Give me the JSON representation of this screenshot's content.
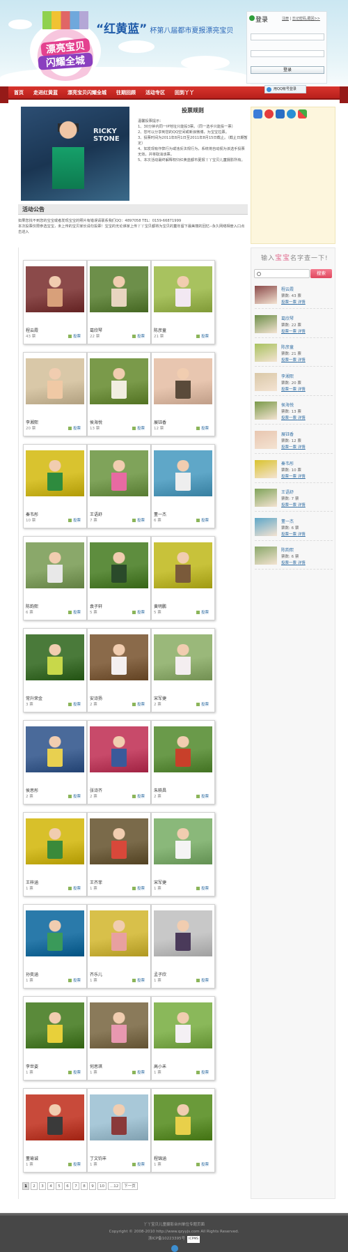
{
  "header": {
    "logo_line1": "漂亮宝贝",
    "logo_line2": "闪耀全城",
    "slogan_quote": "“红黄蓝”",
    "slogan_text": "杯第八届都市夏报漂亮宝贝"
  },
  "login": {
    "title": "登录",
    "register": "注册",
    "forgot": "忘记密码,跟回>>",
    "button": "登录",
    "qq_login": "用QQ帐号登录"
  },
  "nav": {
    "items": [
      "首页",
      "走进红黄蓝",
      "漂亮宝贝闪耀全城",
      "往期回顾",
      "活动专区",
      "回到丫丫"
    ]
  },
  "rules": {
    "title": "投票规则",
    "lines": [
      "温馨投票提示：",
      "1、30分钟内同一IP地址只能投3票。（同一选手只能投一票）",
      "2、您可以分享到您的QQ空间或新浪微博，为宝宝拉票。",
      "3、投票时间为2011年8月1日至2011年8月15日截止。（截止日期暂定）",
      "4、如发现有作弊行为或违反法规行为，系统将自动视为该选手投票无效，并将取消该票。",
      "5、本次活动最终解释权归红黄蓝都市夏报丫丫宝贝儿童摄影所有。"
    ]
  },
  "notice": {
    "title": "活动公告",
    "text1": "如果您找不到您的宝宝或者发现宝宝的照片有错误请联系我们QQ：4897058 TEL：0159-66871999",
    "text2": "本次投票仅限参选宝宝，未上传的宝贝家长请勿投票！宝宝的无论谁家上传丫丫宝贝都将为宝贝的童年留下最美丽的回忆--永久网络相册入口点击进入"
  },
  "gallery": [
    {
      "name": "程云霞",
      "votes": "43 票",
      "vote_label": "投票",
      "c1": "#8b4a4a",
      "c2": "#d8a07a"
    },
    {
      "name": "葛欣琴",
      "votes": "22 票",
      "vote_label": "投票",
      "c1": "#6d8f4a",
      "c2": "#e8d5c0"
    },
    {
      "name": "陈彦童",
      "votes": "21 票",
      "vote_label": "投票",
      "c1": "#a8c25f",
      "c2": "#f2e8f2"
    },
    {
      "name": "李湘熙",
      "votes": "20 票",
      "vote_label": "投票",
      "c1": "#d9c8a8",
      "c2": "#f0c9a5"
    },
    {
      "name": "侯海悦",
      "votes": "13 票",
      "vote_label": "投票",
      "c1": "#7a9a4a",
      "c2": "#f1eee0"
    },
    {
      "name": "展钰香",
      "votes": "12 票",
      "vote_label": "投票",
      "c1": "#e8c6b0",
      "c2": "#5a4a3a"
    },
    {
      "name": "秦韦彤",
      "votes": "10 票",
      "vote_label": "投票",
      "c1": "#d9c32f",
      "c2": "#2e8b3e"
    },
    {
      "name": "王语舒",
      "votes": "7 票",
      "vote_label": "投票",
      "c1": "#7fa35a",
      "c2": "#e86aa2"
    },
    {
      "name": "董一杰",
      "votes": "6 票",
      "vote_label": "投票",
      "c1": "#5fa7c8",
      "c2": "#eeeeee"
    },
    {
      "name": "陈韵熙",
      "votes": "6 票",
      "vote_label": "投票",
      "c1": "#8aa86a",
      "c2": "#e8e8e8"
    },
    {
      "name": "袁子轩",
      "votes": "5 票",
      "vote_label": "投票",
      "c1": "#5e8d3e",
      "c2": "#2a4a2a"
    },
    {
      "name": "黄明鹏",
      "votes": "5 票",
      "vote_label": "投票",
      "c1": "#c8c23a",
      "c2": "#7a5a3a"
    },
    {
      "name": "常升荣金",
      "votes": "3 票",
      "vote_label": "投票",
      "c1": "#4a7a3a",
      "c2": "#c8d84a"
    },
    {
      "name": "安诗扬",
      "votes": "2 票",
      "vote_label": "投票",
      "c1": "#8a6a4a",
      "c2": "#f4f0f0"
    },
    {
      "name": "宋军捷",
      "votes": "2 票",
      "vote_label": "投票",
      "c1": "#9ab87a",
      "c2": "#f4eef0"
    },
    {
      "name": "侯思彤",
      "votes": "2 票",
      "vote_label": "投票",
      "c1": "#4a6a9a",
      "c2": "#e8d050"
    },
    {
      "name": "张诗齐",
      "votes": "2 票",
      "vote_label": "投票",
      "c1": "#c84a6a",
      "c2": "#3a5a9a"
    },
    {
      "name": "朱轶昌",
      "votes": "2 票",
      "vote_label": "投票",
      "c1": "#6a9a4a",
      "c2": "#c8402a"
    },
    {
      "name": "王梓涵",
      "votes": "1 票",
      "vote_label": "投票",
      "c1": "#d8c02a",
      "c2": "#3a8a3a"
    },
    {
      "name": "王齐菲",
      "votes": "1 票",
      "vote_label": "投票",
      "c1": "#7a6a4a",
      "c2": "#d8483a"
    },
    {
      "name": "宋军捷",
      "votes": "1 票",
      "vote_label": "投票",
      "c1": "#8ab87a",
      "c2": "#f4f4f4"
    },
    {
      "name": "孙奕涵",
      "votes": "1 票",
      "vote_label": "投票",
      "c1": "#2a7aaa",
      "c2": "#3a9a5a"
    },
    {
      "name": "齐乐儿",
      "votes": "1 票",
      "vote_label": "投票",
      "c1": "#d8c04a",
      "c2": "#e8a0a0"
    },
    {
      "name": "孟子欣",
      "votes": "1 票",
      "vote_label": "投票",
      "c1": "#c8c8c8",
      "c2": "#4a3a5a"
    },
    {
      "name": "李世姿",
      "votes": "1 票",
      "vote_label": "投票",
      "c1": "#5a8a3a",
      "c2": "#e8d03a"
    },
    {
      "name": "何思琪",
      "votes": "1 票",
      "vote_label": "投票",
      "c1": "#8a7a5a",
      "c2": "#e898b0"
    },
    {
      "name": "高小禾",
      "votes": "1 票",
      "vote_label": "投票",
      "c1": "#8ab85a",
      "c2": "#f4f0f4"
    },
    {
      "name": "董瑜诚",
      "votes": "1 票",
      "vote_label": "投票",
      "c1": "#c84a3a",
      "c2": "#3a3a3a"
    },
    {
      "name": "丁文钧丰",
      "votes": "1 票",
      "vote_label": "投票",
      "c1": "#a8c8d8",
      "c2": "#8a3a3a"
    },
    {
      "name": "程锦涵",
      "votes": "1 票",
      "vote_label": "投票",
      "c1": "#6a9a3a",
      "c2": "#e8d04a"
    }
  ],
  "pager": {
    "pages": [
      "1",
      "2",
      "3",
      "4",
      "5",
      "6",
      "7",
      "8",
      "9",
      "10",
      "...12",
      "下一页"
    ]
  },
  "sidebar": {
    "heading_a": "输入",
    "heading_b": "宝宝",
    "heading_c": "名字查一下!",
    "search_button": "搜索",
    "detail_link": "投票一票",
    "detail_link2": "详情",
    "ranking": [
      {
        "name": "程云霞",
        "votes": "票数: 43 票",
        "c": "#8b4a4a"
      },
      {
        "name": "葛欣琴",
        "votes": "票数: 22 票",
        "c": "#6d8f4a"
      },
      {
        "name": "陈彦童",
        "votes": "票数: 21 票",
        "c": "#a8c25f"
      },
      {
        "name": "李湘熙",
        "votes": "票数: 20 票",
        "c": "#d9c8a8"
      },
      {
        "name": "侯海悦",
        "votes": "票数: 13 票",
        "c": "#7a9a4a"
      },
      {
        "name": "展钰香",
        "votes": "票数: 12 票",
        "c": "#e8c6b0"
      },
      {
        "name": "秦韦彤",
        "votes": "票数: 10 票",
        "c": "#d9c32f"
      },
      {
        "name": "王语舒",
        "votes": "票数: 7 票",
        "c": "#7fa35a"
      },
      {
        "name": "董一杰",
        "votes": "票数: 6 票",
        "c": "#5fa7c8"
      },
      {
        "name": "陈韵熙",
        "votes": "票数: 6 票",
        "c": "#8aa86a"
      }
    ]
  },
  "footer": {
    "line1": "丫丫宝贝儿童摄影台州单位专题页面",
    "line2": "Copyright © 2008-2010 http://www.qzyyjs.com All Rights Reserved.",
    "line3": "浙ICP备10223395号",
    "badge": "ICPMS"
  },
  "colors": {
    "nav_red": "#c8281f",
    "link_blue": "#3470a5",
    "search_pink": "#e0485f",
    "footer_bg": "#474747"
  }
}
